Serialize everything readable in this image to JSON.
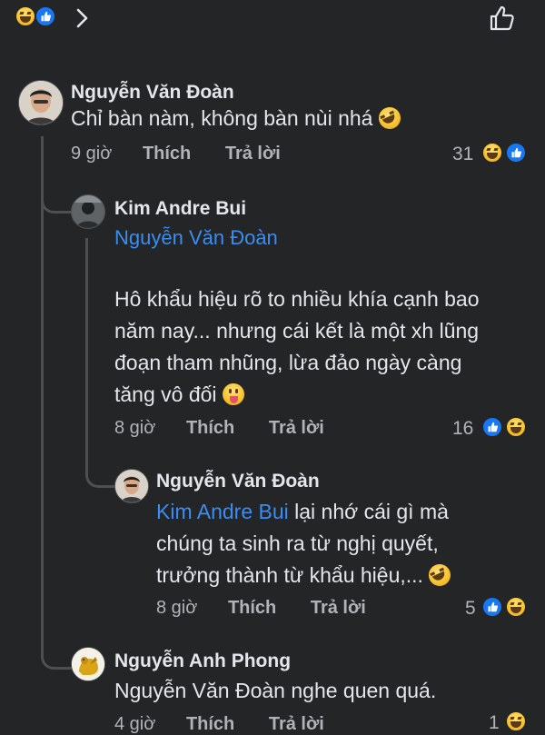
{
  "header": {
    "icons": [
      "haha-icon",
      "like-icon",
      "chevron-right-icon",
      "thumbs-up-outline-icon"
    ]
  },
  "comments": [
    {
      "author": "Nguyễn Văn Đoàn",
      "text": "Chỉ bàn nàm, không bàn nùi nhá",
      "time": "9 giờ",
      "like": "Thích",
      "reply": "Trả lời",
      "reactions": "31"
    },
    {
      "author": "Kim Andre Bui",
      "mention": "Nguyễn Văn Đoàn",
      "lines": [
        "Hô khẩu hiệu rõ to nhiều khía cạnh bao",
        "năm nay... nhưng cái kết là một xh lũng",
        "đoạn tham nhũng, lừa đảo ngày càng",
        "tăng vô đối"
      ],
      "time": "8 giờ",
      "like": "Thích",
      "reply": "Trả lời",
      "reactions": "16"
    },
    {
      "author": "Nguyễn Văn Đoàn",
      "mention": "Kim Andre Bui",
      "lines": [
        " lại nhớ cái gì mà",
        "chúng ta sinh ra từ nghị quyết,",
        "trưởng thành từ khẩu hiệu,..."
      ],
      "time": "8 giờ",
      "like": "Thích",
      "reply": "Trả lời",
      "reactions": "5"
    },
    {
      "author": "Nguyễn Anh Phong",
      "text": "Nguyễn Văn Đoàn nghe quen quá.",
      "time": "4 giờ",
      "like": "Thích",
      "reply": "Trả lời",
      "reactions": "1"
    }
  ]
}
